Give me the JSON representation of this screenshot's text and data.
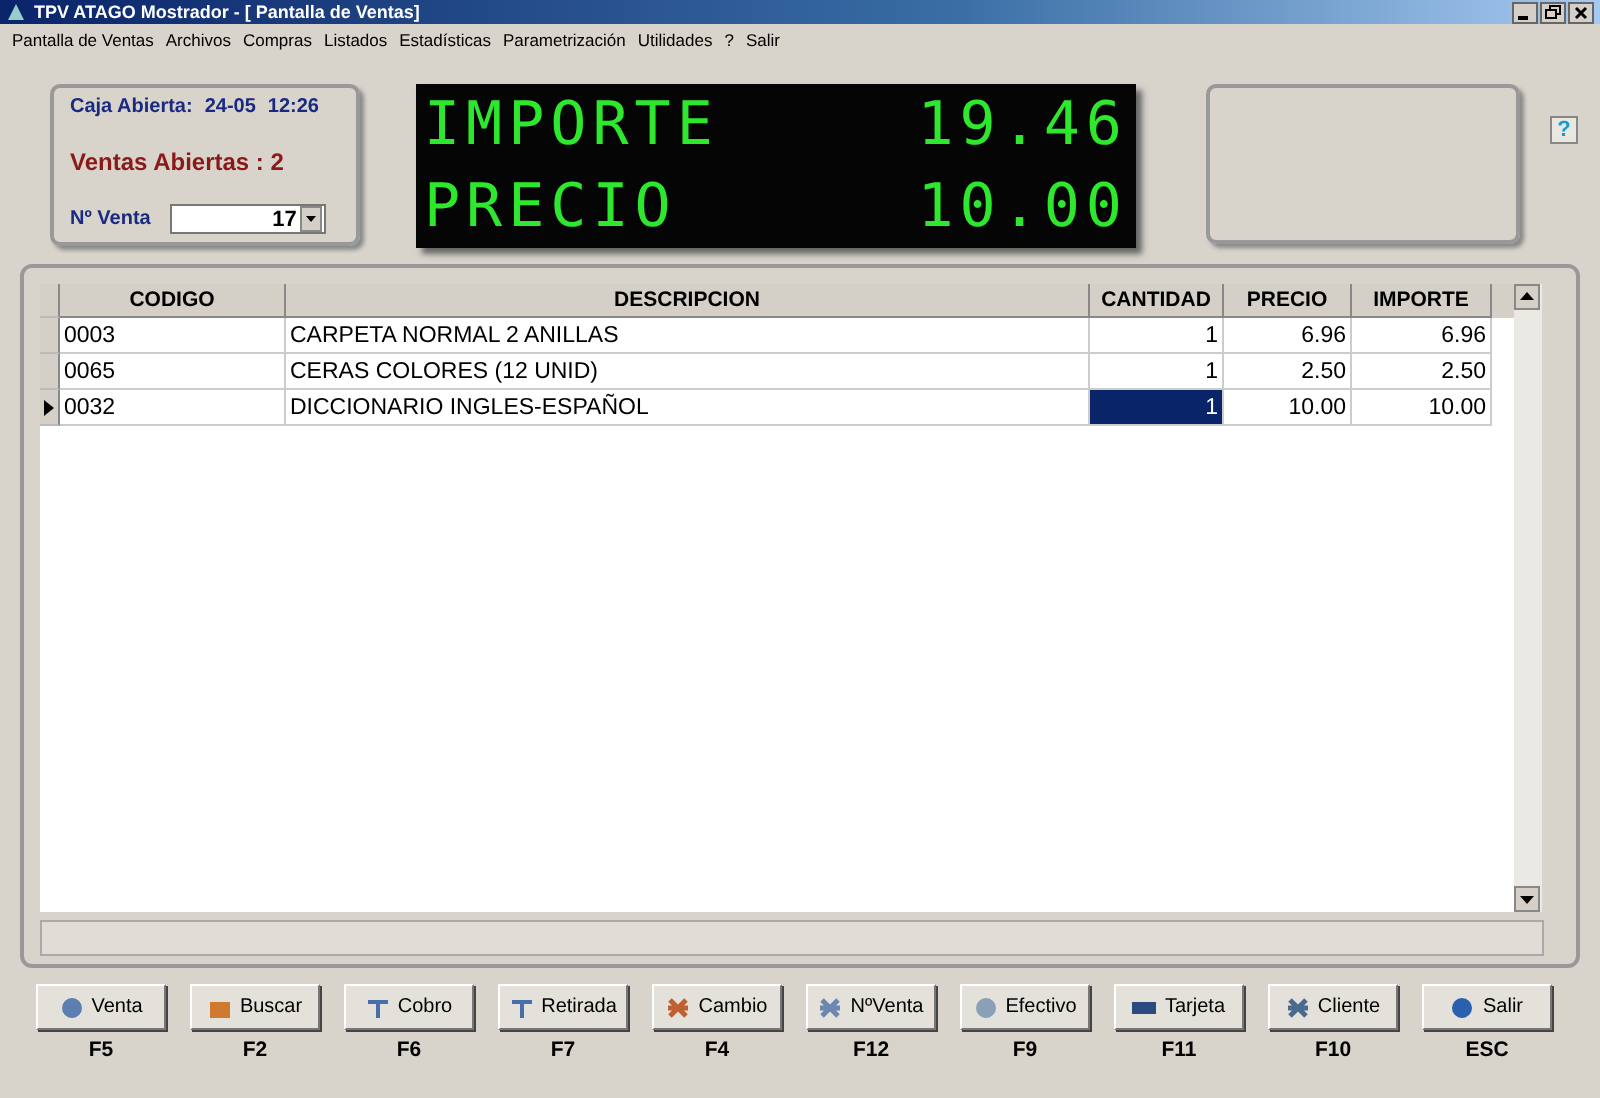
{
  "window": {
    "title": "TPV ATAGO Mostrador - [ Pantalla de Ventas]"
  },
  "menu": [
    "Pantalla de Ventas",
    "Archivos",
    "Compras",
    "Listados",
    "Estadísticas",
    "Parametrización",
    "Utilidades",
    "?",
    "Salir"
  ],
  "caja": {
    "abierta_label": "Caja Abierta:",
    "fecha": "24-05",
    "hora": "12:26",
    "ventas_abiertas": "Ventas Abiertas : 2",
    "venta_label": "Nº Venta",
    "venta_value": "17"
  },
  "display": {
    "line_1": {
      "label": "IMPORTE",
      "value": "19.46"
    },
    "line_2": {
      "label": "PRECIO",
      "value": "10.00"
    }
  },
  "help_button": "?",
  "table": {
    "columns": [
      "CODIGO",
      "DESCRIPCION",
      "CANTIDAD",
      "PRECIO",
      "IMPORTE"
    ],
    "rows": [
      {
        "cells": [
          "0003",
          "CARPETA NORMAL 2 ANILLAS",
          "1",
          "6.96",
          "6.96"
        ],
        "selected": false
      },
      {
        "cells": [
          "0065",
          "CERAS COLORES (12 UNID)",
          "1",
          "2.50",
          "2.50"
        ],
        "selected": false
      },
      {
        "cells": [
          "0032",
          "DICCIONARIO INGLES-ESPAÑOL",
          "1",
          "10.00",
          "10.00"
        ],
        "selected": true
      }
    ]
  },
  "buttons": [
    {
      "label": "Venta",
      "key": "F5"
    },
    {
      "label": "Buscar",
      "key": "F2"
    },
    {
      "label": "Cobro",
      "key": "F6"
    },
    {
      "label": "Retirada",
      "key": "F7"
    },
    {
      "label": "Cambio",
      "key": "F4"
    },
    {
      "label": "NºVenta",
      "key": "F12"
    },
    {
      "label": "Efectivo",
      "key": "F9"
    },
    {
      "label": "Tarjeta",
      "key": "F11"
    },
    {
      "label": "Cliente",
      "key": "F10"
    },
    {
      "label": "Salir",
      "key": "ESC"
    }
  ]
}
